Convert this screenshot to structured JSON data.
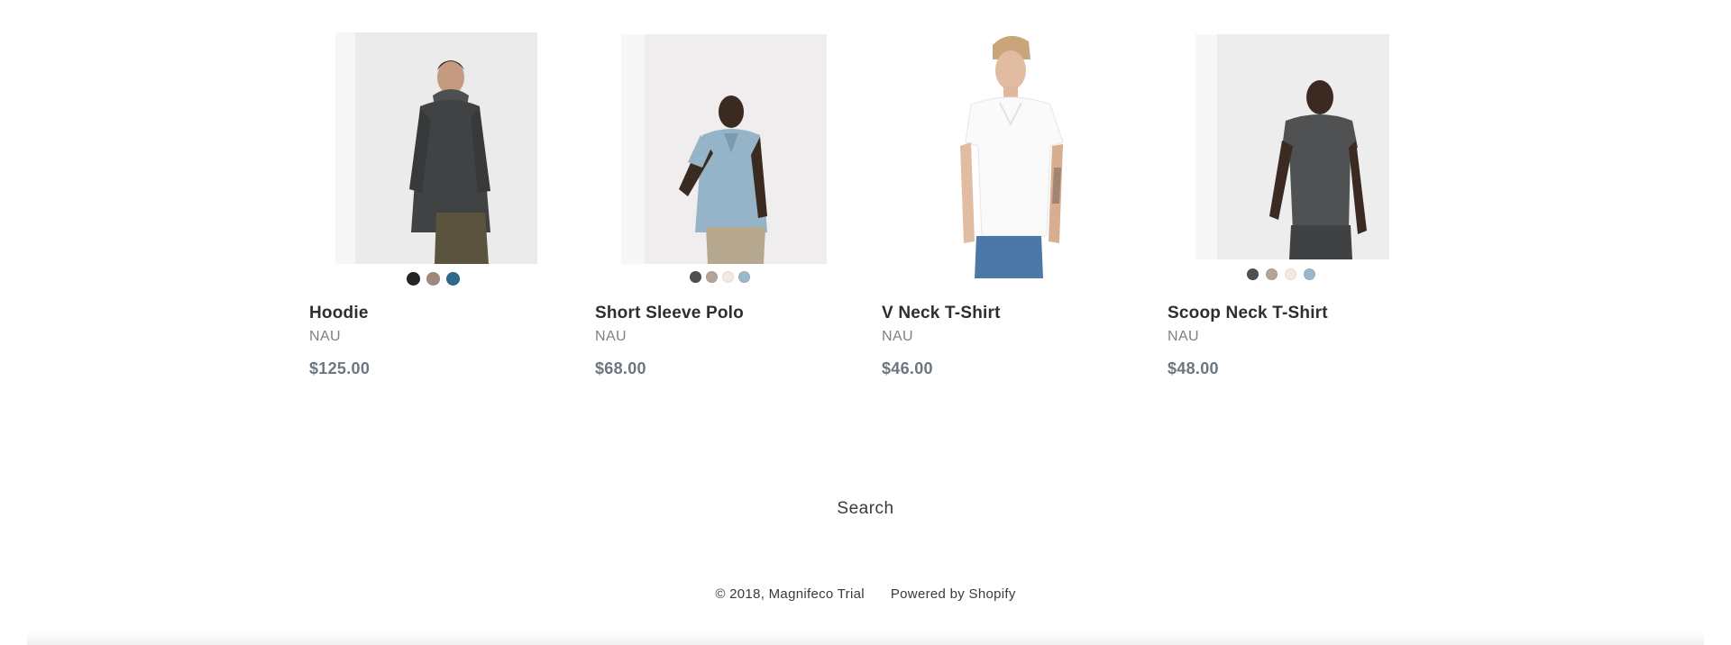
{
  "products": [
    {
      "title": "Hoodie",
      "vendor": "NAU",
      "price": "$125.00",
      "image_alt": "Man wearing charcoal hoodie",
      "swatches": [
        "#222426",
        "#9d8a7c",
        "#2f6a88"
      ]
    },
    {
      "title": "Short Sleeve Polo",
      "vendor": "NAU",
      "price": "$68.00",
      "image_alt": "Man wearing light blue polo",
      "swatches": [
        "#4e4f52",
        "#b5a496",
        "#f2e9e2",
        "#9ab7cc"
      ]
    },
    {
      "title": "V Neck T-Shirt",
      "vendor": "NAU",
      "price": "$46.00",
      "image_alt": "Man wearing white v-neck t-shirt",
      "swatches": []
    },
    {
      "title": "Scoop Neck T-Shirt",
      "vendor": "NAU",
      "price": "$48.00",
      "image_alt": "Man wearing dark grey scoop neck t-shirt",
      "swatches": [
        "#4e4f52",
        "#b5a496",
        "#f2e9e2",
        "#9ab7cc"
      ]
    }
  ],
  "footer": {
    "search_label": "Search",
    "copyright": "© 2018, Magnifeco Trial",
    "powered_by": "Powered by Shopify"
  },
  "colors": {
    "title": "#2e2e2e",
    "vendor": "#808080",
    "price": "#6c7680",
    "background": "#ffffff"
  }
}
